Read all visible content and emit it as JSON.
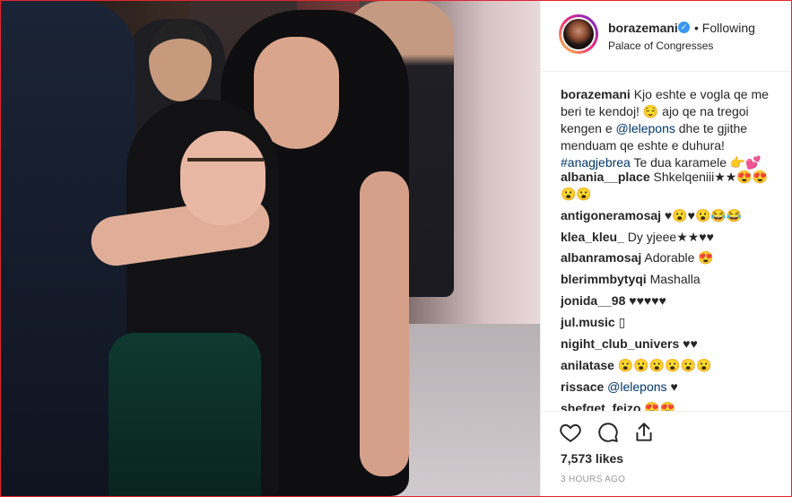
{
  "post": {
    "username": "borazemani",
    "follow_status": "• Following",
    "location": "Palace of Congresses"
  },
  "caption": {
    "username": "borazemani",
    "text_1": " Kjo eshte e vogla qe me beri te kendoj! 😌 ajo qe na tregoi kengen e ",
    "mention": "@lelepons",
    "text_2": " dhe te gjithe menduam qe eshte e duhura! ",
    "hashtag": "#anagjebrea",
    "text_3": " Te dua karamele 👉💕"
  },
  "comments": [
    {
      "user": "albania__place",
      "text": "Shkelqeniii★★😍😍😮😮"
    },
    {
      "user": "antigoneramosaj",
      "text": "♥😮♥😮😂😂"
    },
    {
      "user": "klea_kleu_",
      "text": "Dy yjeee★★♥♥"
    },
    {
      "user": "albanramosaj",
      "text": "Adorable 😍"
    },
    {
      "user": "blerimmbytyqi",
      "text": "Mashalla"
    },
    {
      "user": "jonida__98",
      "text": "♥♥♥♥♥"
    },
    {
      "user": "jul.music",
      "text": "▯"
    },
    {
      "user": "nigiht_club_univers",
      "text": "♥♥"
    },
    {
      "user": "anilatase",
      "text": "😮😮😮😮😮😮"
    },
    {
      "user": "rissace",
      "mention": "@lelepons",
      "text": "♥"
    },
    {
      "user": "shefqet_feizo",
      "text": "😍😍"
    }
  ],
  "likes": "7,573 likes",
  "time": "3 HOURS AGO",
  "icons": [
    "heart-icon",
    "comment-icon",
    "share-icon"
  ],
  "colors": {
    "link": "#003569",
    "verified": "#3897f0",
    "border": "#e0262f"
  }
}
